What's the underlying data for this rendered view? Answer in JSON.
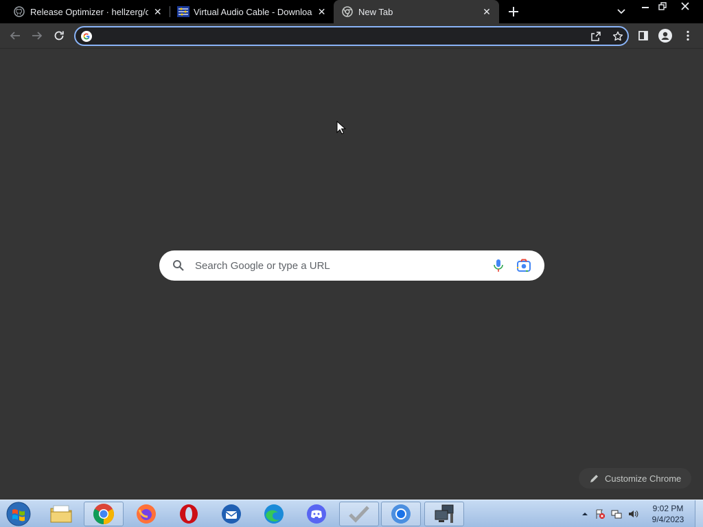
{
  "tabs": [
    {
      "title": "Release Optimizer · hellzerg/opti",
      "favicon": "github-icon",
      "active": false
    },
    {
      "title": "Virtual Audio Cable - Downloads",
      "favicon": "vac-icon",
      "active": false
    },
    {
      "title": "New Tab",
      "favicon": "chrome-icon",
      "active": true
    }
  ],
  "omnibox": {
    "value": ""
  },
  "ntp": {
    "search_placeholder": "Search Google or type a URL",
    "customize_label": "Customize Chrome"
  },
  "taskbar": {
    "apps": [
      "file-explorer",
      "chrome",
      "firefox",
      "opera",
      "thunderbird",
      "edge",
      "discord",
      "checkmark-app",
      "chromium",
      "remote-desktop"
    ]
  },
  "clock": {
    "time": "9:02 PM",
    "date": "9/4/2023"
  },
  "colors": {
    "accent": "#8ab4f8",
    "tab_bg": "#000000",
    "page_bg": "#353535"
  }
}
